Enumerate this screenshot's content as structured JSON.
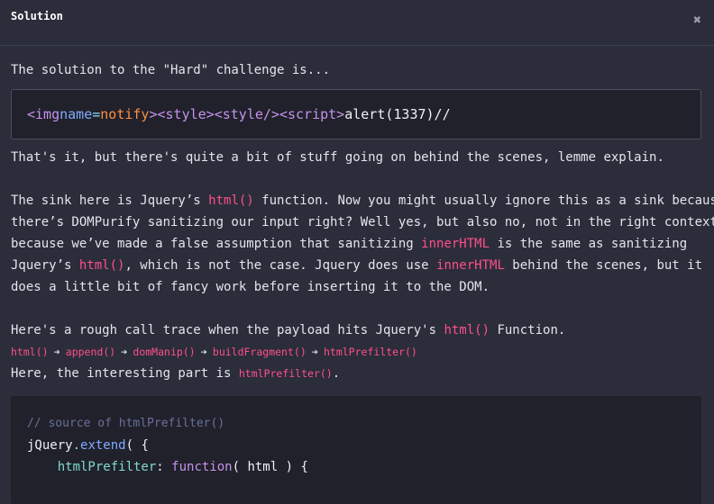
{
  "modal": {
    "title": "Solution",
    "close_glyph": "✖"
  },
  "intro": "The solution to the \"Hard\" challenge is...",
  "payload": {
    "tag_open_1": "<img",
    "attr": "name",
    "eq": "=",
    "attr_value": "notify",
    "tag_close_1": ">",
    "tag_2": "<style>",
    "tag_3": "<style/>",
    "tag_4": "<script>",
    "code": "alert(1337)//"
  },
  "para1": "That's it, but there's quite a bit of stuff going on behind the scenes, lemme explain.",
  "para2": {
    "l1a": "The sink here is Jquery’s ",
    "l1b": "html()",
    "l1c": " function. Now you might usually ignore this as a sink because",
    "l2": "there’s DOMPurify sanitizing our input right? Well yes, but also no, not in the right context,",
    "l3a": "because we’ve made a false assumption that sanitizing ",
    "l3b": "innerHTML",
    "l3c": " is the same as sanitizing",
    "l4a": "Jquery’s ",
    "l4b": "html()",
    "l4c": ", which is not the case. Jquery does use ",
    "l4d": "innerHTML",
    "l4e": " behind the scenes, but it",
    "l5": "does a little bit of fancy work before inserting it to the DOM."
  },
  "para3": {
    "a": "Here's a rough call trace when the payload hits Jquery's ",
    "b": "html()",
    "c": " Function."
  },
  "trace": [
    "html()",
    "append()",
    "domManip()",
    "buildFragment()",
    "htmlPrefilter()"
  ],
  "trace_arrow": "➔",
  "para4": {
    "a": "Here, the interesting part is ",
    "b": "htmlPrefilter()",
    "c": "."
  },
  "code2": {
    "comment": "// source of htmlPrefilter()",
    "l2a": "jQuery",
    "l2b": ".",
    "l2c": "extend",
    "l2d": "( {",
    "l3indent": "    ",
    "l3a": "htmlPrefilter",
    "l3b": ": ",
    "l3c": "function",
    "l3d": "( html ) {"
  },
  "colors": {
    "background": "#2b2d3a",
    "code_bg": "#20212b",
    "accent_pink": "#ff4f8b",
    "tag_purple": "#c792ea",
    "attr_blue": "#82aaff",
    "value_orange": "#ff8f40"
  }
}
